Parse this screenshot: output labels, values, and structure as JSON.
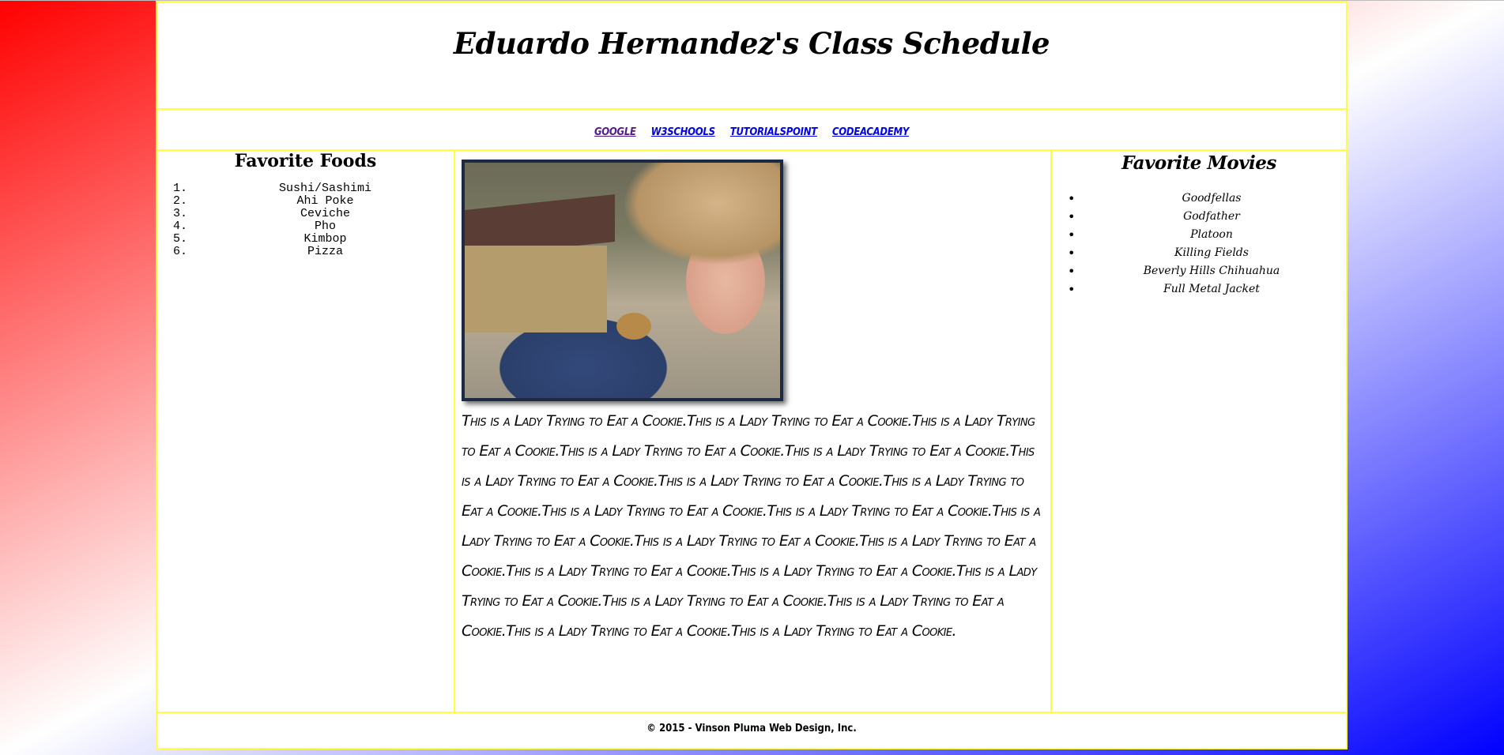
{
  "header": {
    "title": "Eduardo Hernandez's Class Schedule"
  },
  "nav": {
    "links": [
      {
        "label": "Google"
      },
      {
        "label": "W3Schools"
      },
      {
        "label": "TutorialsPoint"
      },
      {
        "label": "CodeAcademy"
      }
    ]
  },
  "left": {
    "heading": "Favorite Foods",
    "foods": [
      {
        "num": "1.",
        "name": "Sushi/Sashimi"
      },
      {
        "num": "2.",
        "name": "Ahi Poke"
      },
      {
        "num": "3.",
        "name": "Ceviche"
      },
      {
        "num": "4.",
        "name": "Pho"
      },
      {
        "num": "5.",
        "name": "Kimbop"
      },
      {
        "num": "6.",
        "name": "Pizza"
      }
    ]
  },
  "main": {
    "story": "This is a Lady Trying to Eat a Cookie.This is a Lady Trying to Eat a Cookie.This is a Lady Trying to Eat a Cookie.This is a Lady Trying to Eat a Cookie.This is a Lady Trying to Eat a Cookie.This is a Lady Trying to Eat a Cookie.This is a Lady Trying to Eat a Cookie.This is a Lady Trying to Eat a Cookie.This is a Lady Trying to Eat a Cookie.This is a Lady Trying to Eat a Cookie.This is a Lady Trying to Eat a Cookie.This is a Lady Trying to Eat a Cookie.This is a Lady Trying to Eat a Cookie.This is a Lady Trying to Eat a Cookie.This is a Lady Trying to Eat a Cookie.This is a Lady Trying to Eat a Cookie.This is a Lady Trying to Eat a Cookie.This is a Lady Trying to Eat a Cookie.This is a Lady Trying to Eat a Cookie.This is a Lady Trying to Eat a Cookie."
  },
  "right": {
    "heading": "Favorite Movies",
    "bullet": "•",
    "movies": [
      {
        "name": "Goodfellas"
      },
      {
        "name": "Godfather"
      },
      {
        "name": "Platoon"
      },
      {
        "name": "Killing Fields"
      },
      {
        "name": "Beverly Hills Chihuahua"
      },
      {
        "name": "Full Metal Jacket"
      }
    ]
  },
  "footer": {
    "text": "© 2015 - Vinson Pluma Web Design, Inc."
  },
  "colors": {
    "border": "#ffff3a",
    "link": "#0000ee",
    "visited_link": "#551a8b",
    "gradient_start": "#ff0000",
    "gradient_end": "#0000ff"
  }
}
